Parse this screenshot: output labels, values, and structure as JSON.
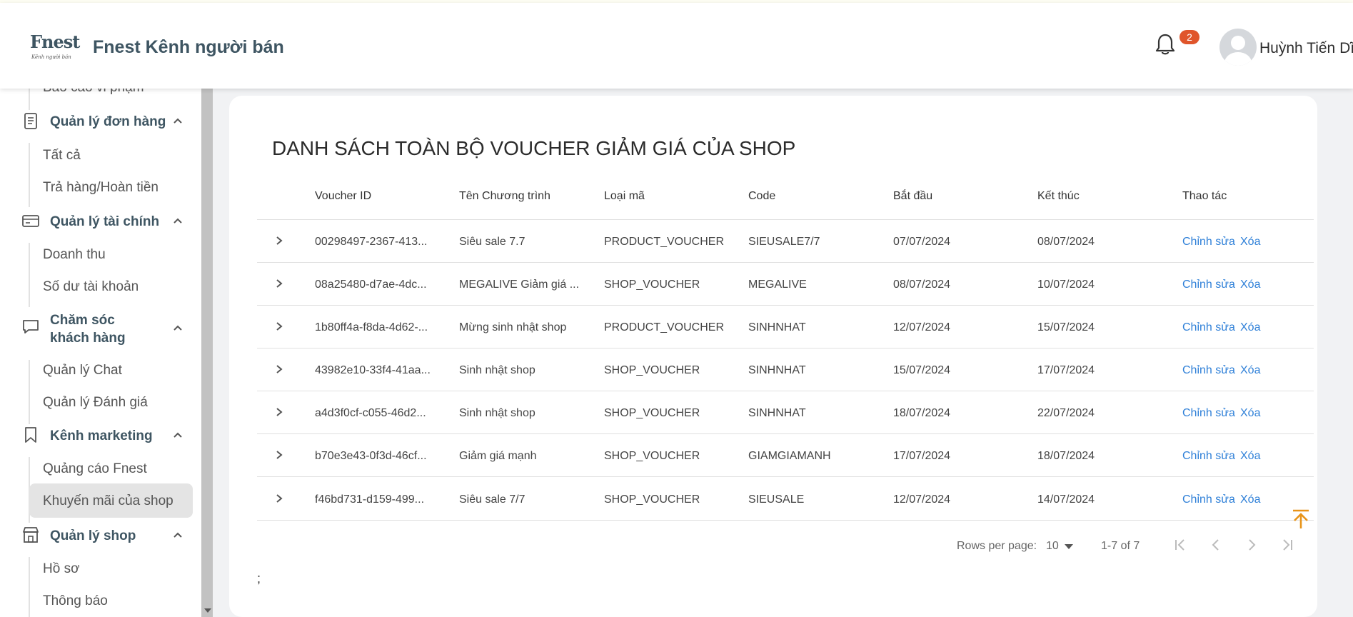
{
  "header": {
    "logo_text": "Fnest",
    "logo_subtitle": "Kênh người bán",
    "title": "Fnest Kênh người bán",
    "notification_count": "2",
    "user_name": "Huỳnh Tiến Dĩ"
  },
  "sidebar": {
    "cut_item": "Báo cáo vi phạm",
    "groups": [
      {
        "label": "Quản lý đơn hàng",
        "icon": "clipboard-icon",
        "items": [
          "Tất cả",
          "Trả hàng/Hoàn tiền"
        ]
      },
      {
        "label": "Quản lý tài chính",
        "icon": "credit-card-icon",
        "items": [
          "Doanh thu",
          "Số dư tài khoản"
        ]
      },
      {
        "label_line1": "Chăm sóc",
        "label_line2": "khách hàng",
        "icon": "chat-bubble-icon",
        "items": [
          "Quản lý Chat",
          "Quản lý Đánh giá"
        ]
      },
      {
        "label": "Kênh marketing",
        "icon": "bookmark-icon",
        "items": [
          "Quảng cáo Fnest",
          "Khuyến mãi của shop"
        ]
      },
      {
        "label": "Quản lý shop",
        "icon": "store-icon",
        "items": [
          "Hồ sơ",
          "Thông báo"
        ]
      }
    ],
    "active_item": "Khuyến mãi của shop"
  },
  "main": {
    "title": "DANH SÁCH TOÀN BỘ VOUCHER GIẢM GIÁ CỦA SHOP",
    "columns": [
      "Voucher ID",
      "Tên Chương trình",
      "Loại mã",
      "Code",
      "Bắt đầu",
      "Kết thúc",
      "Thao tác"
    ],
    "rows": [
      {
        "id": "00298497-2367-413...",
        "name": "Siêu sale 7.7",
        "type": "PRODUCT_VOUCHER",
        "code": "SIEUSALE7/7",
        "start": "07/07/2024",
        "end": "08/07/2024"
      },
      {
        "id": "08a25480-d7ae-4dc...",
        "name": "MEGALIVE Giảm giá ...",
        "type": "SHOP_VOUCHER",
        "code": "MEGALIVE",
        "start": "08/07/2024",
        "end": "10/07/2024"
      },
      {
        "id": "1b80ff4a-f8da-4d62-...",
        "name": "Mừng sinh nhật shop",
        "type": "PRODUCT_VOUCHER",
        "code": "SINHNHAT",
        "start": "12/07/2024",
        "end": "15/07/2024"
      },
      {
        "id": "43982e10-33f4-41aa...",
        "name": "Sinh nhật shop",
        "type": "SHOP_VOUCHER",
        "code": "SINHNHAT",
        "start": "15/07/2024",
        "end": "17/07/2024"
      },
      {
        "id": "a4d3f0cf-c055-46d2...",
        "name": "Sinh nhật shop",
        "type": "SHOP_VOUCHER",
        "code": "SINHNHAT",
        "start": "18/07/2024",
        "end": "22/07/2024"
      },
      {
        "id": "b70e3e43-0f3d-46cf...",
        "name": "Giảm giá mạnh",
        "type": "SHOP_VOUCHER",
        "code": "GIAMGIAMANH",
        "start": "17/07/2024",
        "end": "18/07/2024"
      },
      {
        "id": "f46bd731-d159-499...",
        "name": "Siêu sale 7/7",
        "type": "SHOP_VOUCHER",
        "code": "SIEUSALE",
        "start": "12/07/2024",
        "end": "14/07/2024"
      }
    ],
    "edit_label": "Chỉnh sửa",
    "delete_label": "Xóa",
    "rows_per_page_label": "Rows per page:",
    "rows_per_page_value": "10",
    "range_label": "1-7 of 7",
    "footer_text": ";"
  }
}
